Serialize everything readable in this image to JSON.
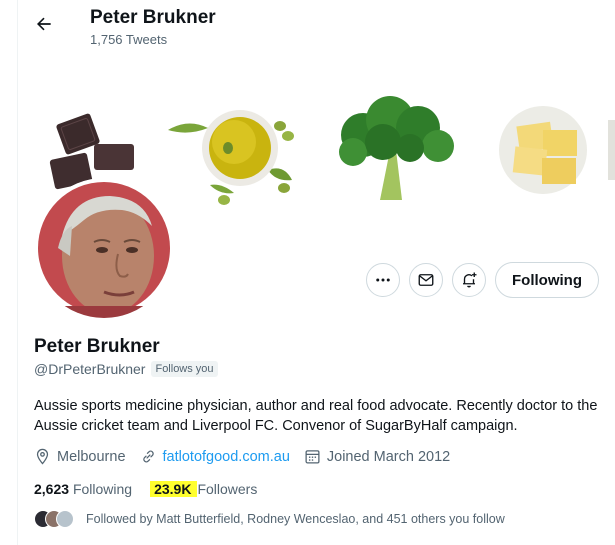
{
  "header": {
    "name": "Peter Brukner",
    "tweets": "1,756 Tweets"
  },
  "actions": {
    "follow_label": "Following"
  },
  "profile": {
    "name": "Peter Brukner",
    "handle": "@DrPeterBrukner",
    "follows_you": "Follows you",
    "bio": "Aussie sports medicine physician, author and real food advocate. Recently doctor to the Aussie cricket team and Liverpool FC. Convenor of SugarByHalf campaign.",
    "location": "Melbourne",
    "website": "fatlotofgood.com.au",
    "joined": "Joined March 2012"
  },
  "stats": {
    "following_count": "2,623",
    "following_label": "Following",
    "followers_count": "23.9K",
    "followers_label": "Followers"
  },
  "followed_by": "Followed by Matt Butterfield, Rodney Wenceslao, and 451 others you follow",
  "colors": {
    "link": "#1d9bf0",
    "highlight": "#ffff2e",
    "secondary_text": "#536471"
  }
}
